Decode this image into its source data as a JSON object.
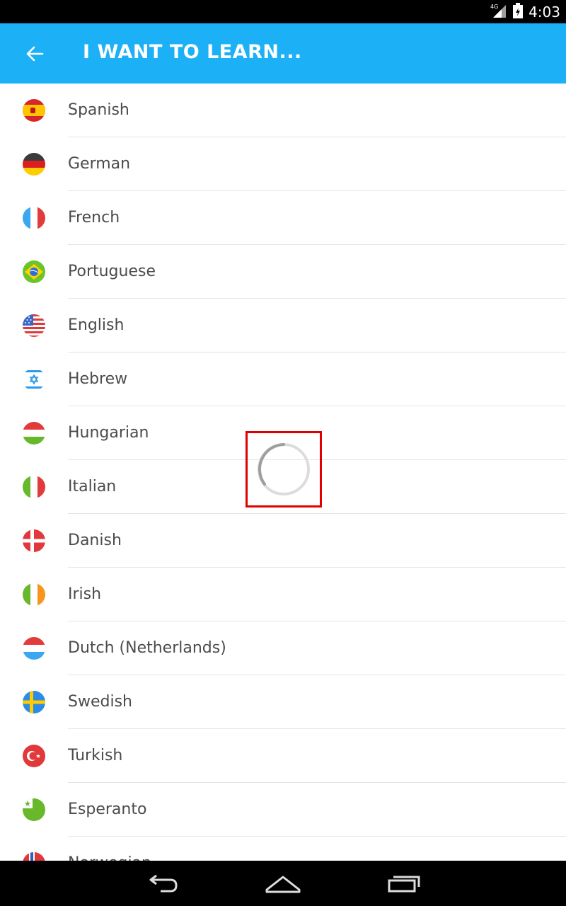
{
  "status_bar": {
    "network": "4G",
    "time": "4:03"
  },
  "app_bar": {
    "title": "I WANT TO LEARN..."
  },
  "languages": [
    {
      "label": "Spanish",
      "flag": "spain-flag-icon"
    },
    {
      "label": "German",
      "flag": "germany-flag-icon"
    },
    {
      "label": "French",
      "flag": "france-flag-icon"
    },
    {
      "label": "Portuguese",
      "flag": "brazil-flag-icon"
    },
    {
      "label": "English",
      "flag": "usa-flag-icon"
    },
    {
      "label": "Hebrew",
      "flag": "israel-flag-icon"
    },
    {
      "label": "Hungarian",
      "flag": "hungary-flag-icon"
    },
    {
      "label": "Italian",
      "flag": "italy-flag-icon"
    },
    {
      "label": "Danish",
      "flag": "denmark-flag-icon"
    },
    {
      "label": "Irish",
      "flag": "ireland-flag-icon"
    },
    {
      "label": "Dutch (Netherlands)",
      "flag": "netherlands-flag-icon"
    },
    {
      "label": "Swedish",
      "flag": "sweden-flag-icon"
    },
    {
      "label": "Turkish",
      "flag": "turkey-flag-icon"
    },
    {
      "label": "Esperanto",
      "flag": "esperanto-flag-icon"
    },
    {
      "label": "Norwegian",
      "flag": "norway-flag-icon"
    }
  ],
  "colors": {
    "accent": "#1cb0f6",
    "text": "#4b4b4b",
    "divider": "#e5e5e5",
    "highlight": "#e00000"
  }
}
